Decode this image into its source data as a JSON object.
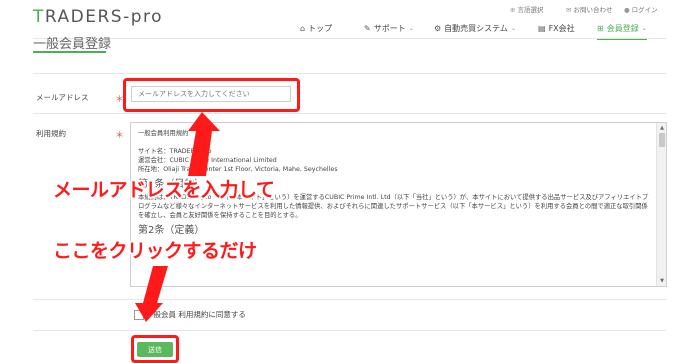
{
  "header": {
    "logo": "TRADERS-pro",
    "utility": {
      "language": "言語選択",
      "contact": "お問い合わせ",
      "login": "ログイン"
    },
    "nav": {
      "top": "トップ",
      "support": "サポート",
      "auto": "自動売買システム",
      "fx": "FX会社",
      "register": "会員登録"
    }
  },
  "page": {
    "title": "一般会員登録"
  },
  "form": {
    "email_label": "メールアドレス",
    "email_placeholder": "メールアドレスを入力してください",
    "terms_label": "利用規約",
    "required_mark": "＊",
    "terms": {
      "heading": "一般会員利用規約",
      "site": "サイト名：TRADERS-pro",
      "company": "運営会社：CUBIC Prime International Limited",
      "address": "所在地：Oliaji Trade Center 1st Floor, Victoria, Mahe, Seychelles",
      "article1_title": "第1条（目的）",
      "article1_text": "本規約は、TRADERS-pro（以下「本サイト」という）を運営するCUBIC Prime Intl. Ltd（以下「当社」という）が、本サイトにおいて提供する出品サービス及びアフィリエイトプログラムなど様々なインターネットサービスを利用した情報提供、およびそれらに関連したサポートサービス（以下「本サービス」という）を利用する会員との間で適正な取引関係を確立し、会員と友好関係を保持することを目的とする。",
      "article2_title": "第2条（定義）"
    },
    "agree_label": "一般会員 利用規約に同意する",
    "submit_label": "送信"
  },
  "annotations": {
    "line1": "メールアドレスを入力して",
    "line2": "ここをクリックするだけ",
    "color": "#ff1a1a"
  },
  "colors": {
    "accent": "#4caf50",
    "button": "#5cb85c",
    "required": "#e05050"
  }
}
